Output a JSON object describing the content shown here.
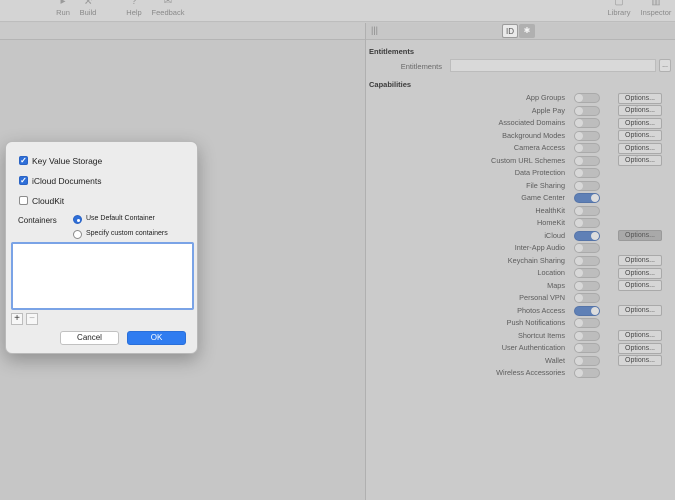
{
  "toolbar": {
    "items": [
      {
        "label": "Run",
        "icon": "play-icon"
      },
      {
        "label": "Build",
        "icon": "hammer-icon"
      },
      {
        "label": "Help",
        "icon": "help-icon"
      },
      {
        "label": "Feedback",
        "icon": "feedback-icon"
      },
      {
        "label": "Library",
        "icon": "library-icon"
      },
      {
        "label": "Inspector",
        "icon": "inspector-icon"
      }
    ]
  },
  "inspector": {
    "entitlements_section": "Entitlements",
    "entitlements_label": "Entitlements",
    "entitlements_value": "",
    "more_button": "...",
    "capabilities_section": "Capabilities",
    "capabilities": [
      {
        "name": "App Groups",
        "on": false,
        "options": "Options..."
      },
      {
        "name": "Apple Pay",
        "on": false,
        "options": "Options..."
      },
      {
        "name": "Associated Domains",
        "on": false,
        "options": "Options..."
      },
      {
        "name": "Background Modes",
        "on": false,
        "options": "Options..."
      },
      {
        "name": "Camera Access",
        "on": false,
        "options": "Options..."
      },
      {
        "name": "Custom URL Schemes",
        "on": false,
        "options": "Options..."
      },
      {
        "name": "Data Protection",
        "on": false,
        "options": ""
      },
      {
        "name": "File Sharing",
        "on": false,
        "options": ""
      },
      {
        "name": "Game Center",
        "on": true,
        "options": ""
      },
      {
        "name": "HealthKit",
        "on": false,
        "options": ""
      },
      {
        "name": "HomeKit",
        "on": false,
        "options": ""
      },
      {
        "name": "iCloud",
        "on": true,
        "options": "Options...",
        "options_active": true
      },
      {
        "name": "Inter-App Audio",
        "on": false,
        "options": ""
      },
      {
        "name": "Keychain Sharing",
        "on": false,
        "options": "Options..."
      },
      {
        "name": "Location",
        "on": false,
        "options": "Options..."
      },
      {
        "name": "Maps",
        "on": false,
        "options": "Options..."
      },
      {
        "name": "Personal VPN",
        "on": false,
        "options": ""
      },
      {
        "name": "Photos Access",
        "on": true,
        "options": "Options..."
      },
      {
        "name": "Push Notifications",
        "on": false,
        "options": ""
      },
      {
        "name": "Shortcut Items",
        "on": false,
        "options": "Options..."
      },
      {
        "name": "User Authentication",
        "on": false,
        "options": "Options..."
      },
      {
        "name": "Wallet",
        "on": false,
        "options": "Options..."
      },
      {
        "name": "Wireless Accessories",
        "on": false,
        "options": ""
      }
    ]
  },
  "dialog": {
    "checkbox_kv": "Key Value Storage",
    "checkbox_kv_checked": true,
    "checkbox_docs": "iCloud Documents",
    "checkbox_docs_checked": true,
    "checkbox_cloudkit": "CloudKit",
    "checkbox_cloudkit_checked": false,
    "containers_label": "Containers",
    "radio_default": "Use Default Container",
    "radio_custom": "Specify custom containers",
    "selected_radio": "default",
    "plus": "+",
    "minus": "−",
    "cancel": "Cancel",
    "ok": "OK"
  },
  "colors": {
    "accent": "#2f7cf0",
    "switch_on": "#5f80b6"
  }
}
